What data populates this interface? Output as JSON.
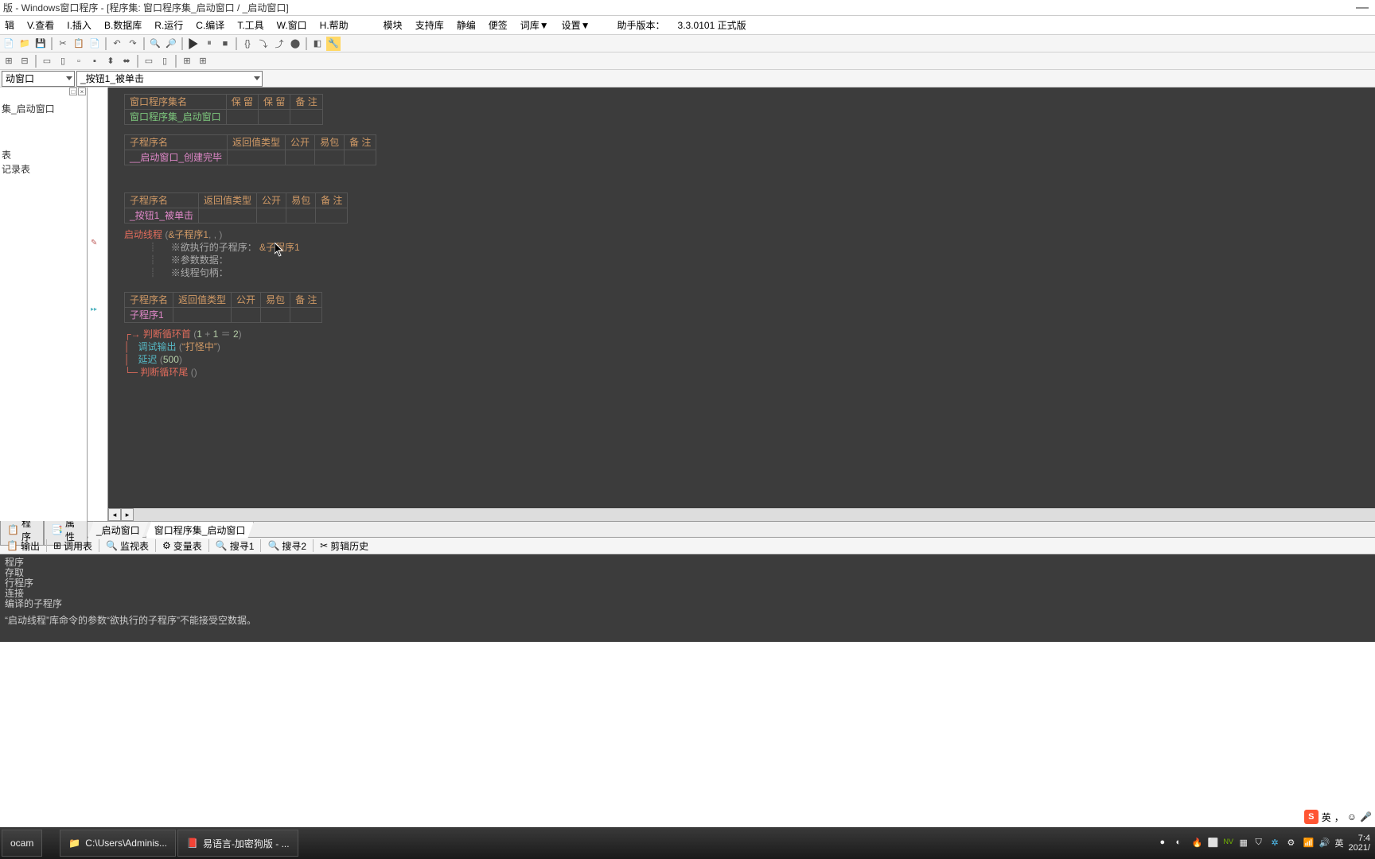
{
  "title": "版 - Windows窗口程序 - [程序集: 窗口程序集_启动窗口 / _启动窗口]",
  "minimize": "—",
  "menu": [
    "辑",
    "V.查看",
    "I.插入",
    "B.数据库",
    "R.运行",
    "C.编译",
    "T.工具",
    "W.窗口",
    "H.帮助",
    "模块",
    "支持库",
    "静编",
    "便签",
    "词库▼",
    "设置▼",
    "助手版本：",
    "3.3.0101 正式版"
  ],
  "dd1": "动窗口",
  "dd2": "_按钮1_被单击",
  "tree": {
    "t1": "",
    "t2": "集_启动窗口",
    "t3": "表",
    "t4": "记录表"
  },
  "table1": {
    "h": [
      "窗口程序集名",
      "保 留",
      "保 留",
      "备 注"
    ],
    "r": [
      "窗口程序集_启动窗口",
      "",
      "",
      ""
    ]
  },
  "table2": {
    "h": [
      "子程序名",
      "返回值类型",
      "公开",
      "易包",
      "备 注"
    ],
    "r": [
      "__启动窗口_创建完毕",
      "",
      "",
      "",
      ""
    ]
  },
  "table3": {
    "h": [
      "子程序名",
      "返回值类型",
      "公开",
      "易包",
      "备 注"
    ],
    "r": [
      "_按钮1_被单击",
      "",
      "",
      "",
      ""
    ]
  },
  "codeA": {
    "l1a": "启动线程",
    "l1b": "(",
    "l1c": "&子程序1",
    "l1d": ", , )",
    "l2": "    ※欲执行的子程序：",
    "l2v": "&子程序1",
    "l3": "    ※参数数据：",
    "l4": "    ※线程句柄："
  },
  "table4": {
    "h": [
      "子程序名",
      "返回值类型",
      "公开",
      "易包",
      "备 注"
    ],
    "r": [
      "子程序1",
      "",
      "",
      "",
      ""
    ]
  },
  "codeB": {
    "l1a": "判断循环首",
    "l1p": "(",
    "l1b": "1",
    "l1c": " + ",
    "l1d": "1",
    "l1e": " ＝ ",
    "l1f": "2",
    "l1q": ")",
    "l2a": "调试输出",
    "l2p": "(",
    "l2b": "“打怪中”",
    "l2q": ")",
    "l3a": "延迟",
    "l3p": "(",
    "l3b": "500",
    "l3q": ")",
    "l4a": "判断循环尾",
    "l4p": "()"
  },
  "leftbot": {
    "t1": "程序",
    "t2": "属性"
  },
  "codebot": {
    "t1": "_启动窗口",
    "t2": "窗口程序集_启动窗口"
  },
  "out_tabs": [
    "输出",
    "调用表",
    "监视表",
    "变量表",
    "搜寻1",
    "搜寻2",
    "剪辑历史"
  ],
  "output": {
    "l1": "程序",
    "l2": "存取",
    "l3": "行程序",
    "l4": "连接",
    "l5": "编译的子程序",
    "l6": "“启动线程”库命令的参数“欲执行的子程序”不能接受空数据。"
  },
  "ime": {
    "s": "S",
    "lang": "英",
    "sep": "，"
  },
  "taskbar": {
    "t1": "ocam",
    "t2": "C:\\Users\\Adminis...",
    "t3": "易语言-加密狗版 - ...",
    "lang": "英",
    "time": "7:4",
    "date": "2021/"
  },
  "tray_icons": [
    "●",
    "◐",
    "🔥",
    "⬜",
    "NV",
    "▦",
    "⛉",
    "✲",
    "⚙",
    "📶",
    "🔊",
    "英"
  ]
}
